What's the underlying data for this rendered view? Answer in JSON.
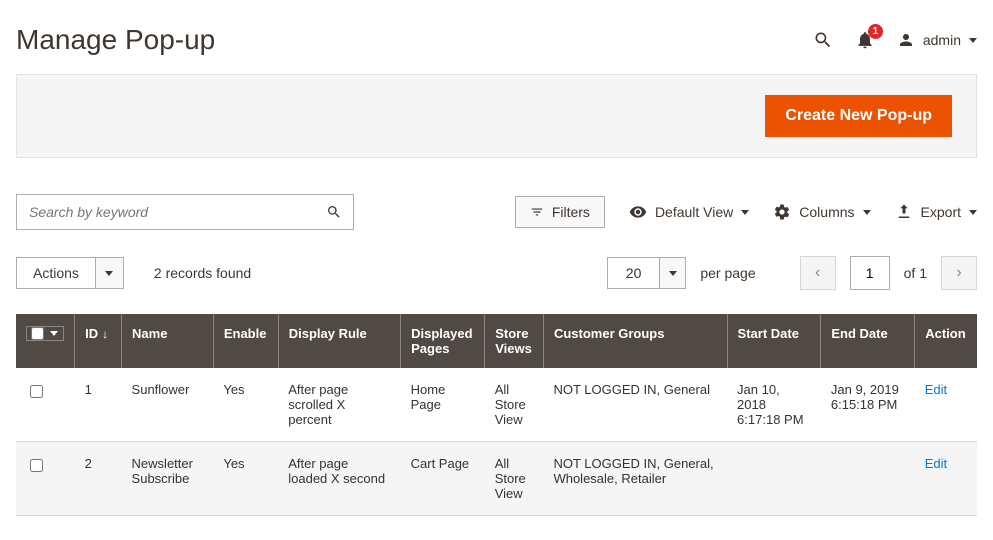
{
  "header": {
    "title": "Manage Pop-up",
    "notification_count": "1",
    "user_name": "admin"
  },
  "action_bar": {
    "create_label": "Create New Pop-up"
  },
  "toolbar": {
    "search_placeholder": "Search by keyword",
    "filters_label": "Filters",
    "default_view_label": "Default View",
    "columns_label": "Columns",
    "export_label": "Export"
  },
  "controls": {
    "actions_label": "Actions",
    "records_found": "2 records found",
    "per_page_value": "20",
    "per_page_label": "per page",
    "page_current": "1",
    "page_of": "of 1"
  },
  "table": {
    "headers": {
      "id": "ID",
      "name": "Name",
      "enable": "Enable",
      "display_rule": "Display Rule",
      "displayed_pages": "Displayed Pages",
      "store_views": "Store Views",
      "customer_groups": "Customer Groups",
      "start_date": "Start Date",
      "end_date": "End Date",
      "action": "Action"
    },
    "rows": [
      {
        "id": "1",
        "name": "Sunflower",
        "enable": "Yes",
        "display_rule": "After page scrolled X percent",
        "displayed_pages": "Home Page",
        "store_views": "All Store View",
        "customer_groups": "NOT LOGGED IN, General",
        "start_date": "Jan 10, 2018 6:17:18 PM",
        "end_date": "Jan 9, 2019 6:15:18 PM",
        "action": "Edit"
      },
      {
        "id": "2",
        "name": "Newsletter Subscribe",
        "enable": "Yes",
        "display_rule": "After page loaded X second",
        "displayed_pages": "Cart Page",
        "store_views": "All Store View",
        "customer_groups": "NOT LOGGED IN, General, Wholesale, Retailer",
        "start_date": "",
        "end_date": "",
        "action": "Edit"
      }
    ]
  }
}
